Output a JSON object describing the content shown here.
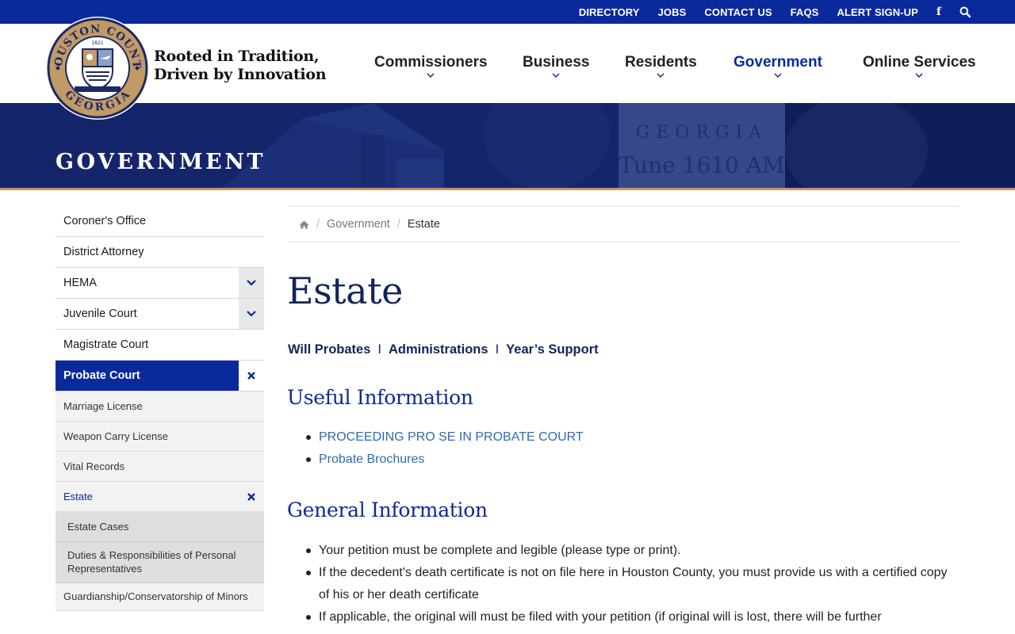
{
  "topbar": {
    "links": [
      "DIRECTORY",
      "JOBS",
      "CONTACT US",
      "FAQS",
      "ALERT SIGN-UP"
    ],
    "facebook_glyph": "f"
  },
  "header": {
    "seal_text_top": "HOUSTON COUNTY",
    "seal_text_bottom": "GEORGIA",
    "seal_year": "1821",
    "tagline_line1": "Rooted in Tradition,",
    "tagline_line2": "Driven by Innovation"
  },
  "nav": [
    {
      "label": "Commissioners",
      "active": false
    },
    {
      "label": "Business",
      "active": false
    },
    {
      "label": "Residents",
      "active": false
    },
    {
      "label": "Government",
      "active": true
    },
    {
      "label": "Online Services",
      "active": false
    }
  ],
  "banner": {
    "title": "GOVERNMENT",
    "photo_text1": "GEORGIA",
    "photo_text2": "Tune 1610 AM"
  },
  "sidebar": [
    {
      "label": "Coroner's Office",
      "level": "top"
    },
    {
      "label": "District Attorney",
      "level": "top"
    },
    {
      "label": "HEMA",
      "level": "top",
      "toggle": "expand"
    },
    {
      "label": "Juvenile Court",
      "level": "top",
      "toggle": "expand"
    },
    {
      "label": "Magistrate Court",
      "level": "top"
    },
    {
      "label": "Probate Court",
      "level": "active",
      "toggle": "close"
    },
    {
      "label": "Marriage License",
      "level": "sub"
    },
    {
      "label": "Weapon Carry License",
      "level": "sub"
    },
    {
      "label": "Vital Records",
      "level": "sub"
    },
    {
      "label": "Estate",
      "level": "sub-current",
      "toggle": "close"
    },
    {
      "label": "Estate Cases",
      "level": "subsub"
    },
    {
      "label": "Duties & Responsibilities of Personal Representatives",
      "level": "subsub-multi"
    },
    {
      "label": "Guardianship/Conservatorship of Minors",
      "level": "sub-multi"
    }
  ],
  "breadcrumb": {
    "home_icon": "home-icon",
    "parent": "Government",
    "current": "Estate"
  },
  "main": {
    "title": "Estate",
    "quicklinks": [
      "Will Probates",
      "Administrations",
      "Year’s Support"
    ],
    "quicklink_separators": [
      "I",
      "I"
    ],
    "useful_heading": "Useful Information",
    "useful_links": [
      "PROCEEDING PRO SE IN PROBATE COURT",
      "Probate Brochures"
    ],
    "general_heading": "General Information",
    "general_items": [
      "Your petition must be complete and legible (please type or print).",
      "If the decedent's death certificate is not on file here in Houston County, you must provide us with a certified copy of his or her death certificate",
      "If applicable, the original will must be filed with your petition (if original will is lost, there will be further"
    ]
  },
  "colors": {
    "primary_blue": "#0a2a9c",
    "navy_text": "#13245a",
    "link_blue": "#2f6bb0",
    "accent_copper": "#c7925a"
  }
}
